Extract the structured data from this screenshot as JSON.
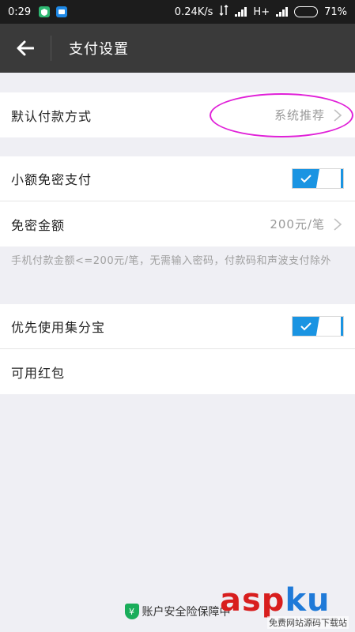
{
  "status_bar": {
    "time": "0:29",
    "net_speed": "0.24K/s",
    "network_type": "H+",
    "battery": "71%",
    "battery_level": 0.71
  },
  "header": {
    "title": "支付设置",
    "back_icon": "arrow-left-icon"
  },
  "settings": {
    "default_payment": {
      "label": "默认付款方式",
      "value": "系统推荐"
    },
    "small_amount": {
      "label": "小额免密支付",
      "enabled": true
    },
    "amount": {
      "label": "免密金额",
      "value": "200元/笔"
    },
    "note": "手机付款金额<=200元/笔，无需输入密码，付款码和声波支付除外",
    "jifenbao": {
      "label": "优先使用集分宝",
      "enabled": true
    },
    "red_packet": {
      "label": "可用红包"
    }
  },
  "footer": {
    "shield_symbol": "¥",
    "text": "账户安全险保障中"
  },
  "watermark": {
    "main_a": "asp",
    "main_b": "ku",
    "sub": "免费网站源码下载站"
  },
  "colors": {
    "accent": "#1a94e2",
    "appbar": "#3a3a3a",
    "highlight": "#e020d8",
    "shield": "#1aad5a"
  }
}
